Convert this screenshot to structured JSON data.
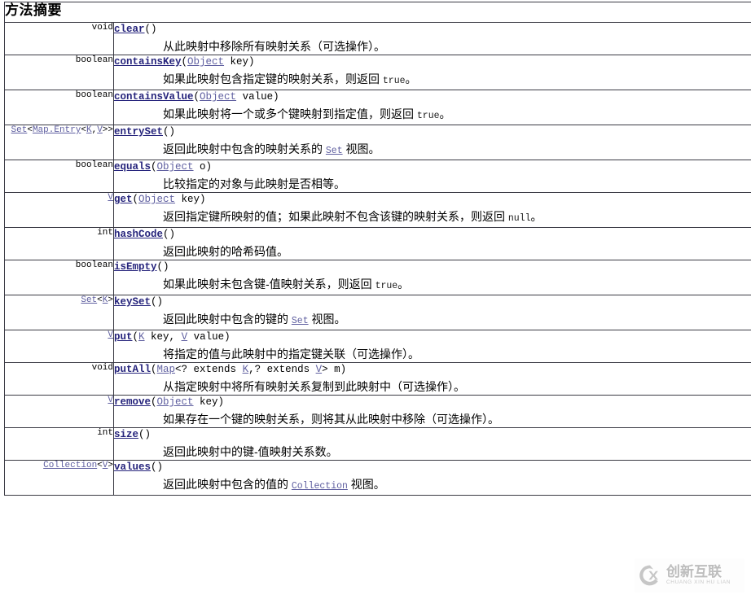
{
  "banner": {
    "title": "方法摘要"
  },
  "table": {
    "rows": [
      {
        "return_type": {
          "text": "void",
          "link": false
        },
        "method": "clear",
        "params": "()",
        "param_parts": [],
        "description": "从此映射中移除所有映射关系（可选操作）。",
        "desc_parts": [
          {
            "t": "从此映射中移除所有映射关系（可选操作）。",
            "s": "text"
          }
        ]
      },
      {
        "return_type": {
          "text": "boolean",
          "link": false
        },
        "method": "containsKey",
        "params": "(Object  key)",
        "param_parts": [
          {
            "t": "(",
            "s": "text"
          },
          {
            "t": "Object",
            "s": "link"
          },
          {
            "t": "  key)",
            "s": "text"
          }
        ],
        "description": "如果此映射包含指定键的映射关系，则返回 true。",
        "desc_parts": [
          {
            "t": "如果此映射包含指定键的映射关系，则返回 ",
            "s": "text"
          },
          {
            "t": "true",
            "s": "code"
          },
          {
            "t": "。",
            "s": "text"
          }
        ]
      },
      {
        "return_type": {
          "text": "boolean",
          "link": false
        },
        "method": "containsValue",
        "params": "(Object  value)",
        "param_parts": [
          {
            "t": "(",
            "s": "text"
          },
          {
            "t": "Object",
            "s": "link"
          },
          {
            "t": "  value)",
            "s": "text"
          }
        ],
        "description": "如果此映射将一个或多个键映射到指定值，则返回 true。",
        "desc_parts": [
          {
            "t": "如果此映射将一个或多个键映射到指定值，则返回 ",
            "s": "text"
          },
          {
            "t": "true",
            "s": "code"
          },
          {
            "t": "。",
            "s": "text"
          }
        ]
      },
      {
        "return_type": {
          "text": "Set<Map.Entry<K,V>>",
          "link": true
        },
        "rtype_parts": [
          {
            "t": "Set",
            "s": "link"
          },
          {
            "t": "<",
            "s": "text"
          },
          {
            "t": "Map.Entry",
            "s": "link"
          },
          {
            "t": "<",
            "s": "text"
          },
          {
            "t": "K",
            "s": "link"
          },
          {
            "t": ",",
            "s": "text"
          },
          {
            "t": "V",
            "s": "link"
          },
          {
            "t": ">>",
            "s": "text"
          }
        ],
        "method": "entrySet",
        "params": "()",
        "param_parts": [
          {
            "t": "()",
            "s": "text"
          }
        ],
        "description": "返回此映射中包含的映射关系的 Set 视图。",
        "desc_parts": [
          {
            "t": "返回此映射中包含的映射关系的 ",
            "s": "text"
          },
          {
            "t": "Set",
            "s": "codelink"
          },
          {
            "t": " 视图。",
            "s": "text"
          }
        ]
      },
      {
        "return_type": {
          "text": "boolean",
          "link": false
        },
        "method": "equals",
        "params": "(Object  o)",
        "param_parts": [
          {
            "t": "(",
            "s": "text"
          },
          {
            "t": "Object",
            "s": "link"
          },
          {
            "t": "  o)",
            "s": "text"
          }
        ],
        "description": "比较指定的对象与此映射是否相等。",
        "desc_parts": [
          {
            "t": "比较指定的对象与此映射是否相等。",
            "s": "text"
          }
        ]
      },
      {
        "return_type": {
          "text": "V",
          "link": true
        },
        "rtype_parts": [
          {
            "t": "V",
            "s": "link"
          }
        ],
        "method": "get",
        "params": "(Object  key)",
        "param_parts": [
          {
            "t": "(",
            "s": "text"
          },
          {
            "t": "Object",
            "s": "link"
          },
          {
            "t": "  key)",
            "s": "text"
          }
        ],
        "description": "返回指定键所映射的值；如果此映射不包含该键的映射关系，则返回 null。",
        "desc_parts": [
          {
            "t": "返回指定键所映射的值；如果此映射不包含该键的映射关系，则返回 ",
            "s": "text"
          },
          {
            "t": "null",
            "s": "code"
          },
          {
            "t": "。",
            "s": "text"
          }
        ]
      },
      {
        "return_type": {
          "text": "int",
          "link": false
        },
        "method": "hashCode",
        "params": "()",
        "param_parts": [
          {
            "t": "()",
            "s": "text"
          }
        ],
        "description": "返回此映射的哈希码值。",
        "desc_parts": [
          {
            "t": "返回此映射的哈希码值。",
            "s": "text"
          }
        ]
      },
      {
        "return_type": {
          "text": "boolean",
          "link": false
        },
        "method": "isEmpty",
        "params": "()",
        "param_parts": [
          {
            "t": "()",
            "s": "text"
          }
        ],
        "description": "如果此映射未包含键-值映射关系，则返回 true。",
        "desc_parts": [
          {
            "t": "如果此映射未包含键-值映射关系，则返回 ",
            "s": "text"
          },
          {
            "t": "true",
            "s": "code"
          },
          {
            "t": "。",
            "s": "text"
          }
        ]
      },
      {
        "return_type": {
          "text": "Set<K>",
          "link": true
        },
        "rtype_parts": [
          {
            "t": "Set",
            "s": "link"
          },
          {
            "t": "<",
            "s": "text"
          },
          {
            "t": "K",
            "s": "link"
          },
          {
            "t": ">",
            "s": "text"
          }
        ],
        "method": "keySet",
        "params": "()",
        "param_parts": [
          {
            "t": "()",
            "s": "text"
          }
        ],
        "description": "返回此映射中包含的键的 Set 视图。",
        "desc_parts": [
          {
            "t": "返回此映射中包含的键的 ",
            "s": "text"
          },
          {
            "t": "Set",
            "s": "codelink"
          },
          {
            "t": " 视图。",
            "s": "text"
          }
        ]
      },
      {
        "return_type": {
          "text": "V",
          "link": true
        },
        "rtype_parts": [
          {
            "t": "V",
            "s": "link"
          }
        ],
        "method": "put",
        "params": "(K  key, V  value)",
        "param_parts": [
          {
            "t": "(",
            "s": "text"
          },
          {
            "t": "K",
            "s": "link"
          },
          {
            "t": "  key, ",
            "s": "text"
          },
          {
            "t": "V",
            "s": "link"
          },
          {
            "t": "  value)",
            "s": "text"
          }
        ],
        "description": "将指定的值与此映射中的指定键关联（可选操作）。",
        "desc_parts": [
          {
            "t": "将指定的值与此映射中的指定键关联（可选操作）。",
            "s": "text"
          }
        ]
      },
      {
        "return_type": {
          "text": "void",
          "link": false
        },
        "method": "putAll",
        "params": "(Map<? extends K,? extends V>  m)",
        "param_parts": [
          {
            "t": "(",
            "s": "text"
          },
          {
            "t": "Map",
            "s": "link"
          },
          {
            "t": "<? extends ",
            "s": "text"
          },
          {
            "t": "K",
            "s": "link"
          },
          {
            "t": ",? extends ",
            "s": "text"
          },
          {
            "t": "V",
            "s": "link"
          },
          {
            "t": ">  m)",
            "s": "text"
          }
        ],
        "description": "从指定映射中将所有映射关系复制到此映射中（可选操作）。",
        "desc_parts": [
          {
            "t": "从指定映射中将所有映射关系复制到此映射中（可选操作）。",
            "s": "text"
          }
        ]
      },
      {
        "return_type": {
          "text": "V",
          "link": true
        },
        "rtype_parts": [
          {
            "t": "V",
            "s": "link"
          }
        ],
        "method": "remove",
        "params": "(Object  key)",
        "param_parts": [
          {
            "t": "(",
            "s": "text"
          },
          {
            "t": "Object",
            "s": "link"
          },
          {
            "t": "  key)",
            "s": "text"
          }
        ],
        "description": "如果存在一个键的映射关系，则将其从此映射中移除（可选操作）。",
        "desc_parts": [
          {
            "t": "如果存在一个键的映射关系，则将其从此映射中移除（可选操作）。",
            "s": "text"
          }
        ]
      },
      {
        "return_type": {
          "text": "int",
          "link": false
        },
        "method": "size",
        "params": "()",
        "param_parts": [
          {
            "t": "()",
            "s": "text"
          }
        ],
        "description": "返回此映射中的键-值映射关系数。",
        "desc_parts": [
          {
            "t": "返回此映射中的键-值映射关系数。",
            "s": "text"
          }
        ]
      },
      {
        "return_type": {
          "text": "Collection<V>",
          "link": true
        },
        "rtype_parts": [
          {
            "t": "Collection",
            "s": "link"
          },
          {
            "t": "<",
            "s": "text"
          },
          {
            "t": "V",
            "s": "link"
          },
          {
            "t": ">",
            "s": "text"
          }
        ],
        "method": "values",
        "params": "()",
        "param_parts": [
          {
            "t": "()",
            "s": "text"
          }
        ],
        "description": "返回此映射中包含的值的 Collection 视图。",
        "desc_parts": [
          {
            "t": "返回此映射中包含的值的 ",
            "s": "text"
          },
          {
            "t": "Collection",
            "s": "codelink"
          },
          {
            "t": " 视图。",
            "s": "text"
          }
        ]
      }
    ]
  },
  "watermark": {
    "mark": "cx-circle-logo",
    "chinese": "创新互联",
    "pinyin": "CHUANG XIN HU LIAN",
    "color": "#bdbdbd"
  },
  "colors": {
    "banner_background": "#ccccff",
    "border": "#3a3a44",
    "member_link": "#26247c",
    "type_link": "#5f5fa0",
    "page_background": "#ffffff"
  }
}
